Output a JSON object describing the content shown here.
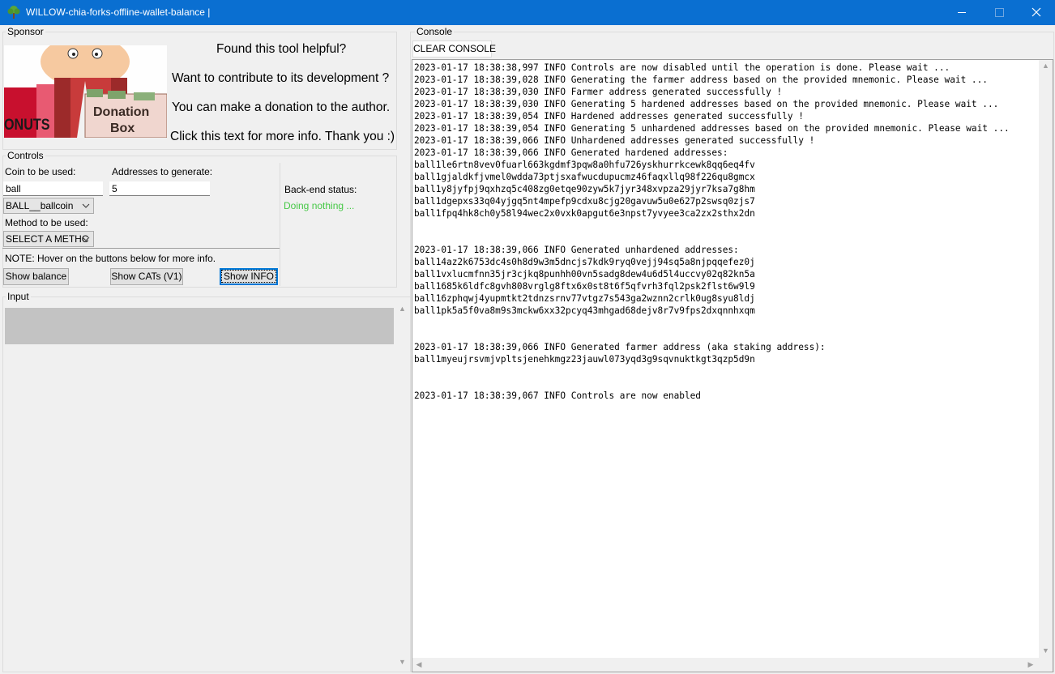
{
  "window": {
    "title": "WILLOW-chia-forks-offline-wallet-balance |",
    "icon": "tree-icon",
    "controls": {
      "minimize": "—",
      "maximize": "☐",
      "close": "✕"
    }
  },
  "sponsor": {
    "label": "Sponsor",
    "image_text": {
      "donation": "Donation",
      "box": "Box",
      "donuts": "ONUTS"
    },
    "lines": [
      "Found this tool helpful?",
      "Want to contribute to its development ?",
      "You can make a donation to the author.",
      "Click this text for more info. Thank you :)"
    ]
  },
  "controls": {
    "label": "Controls",
    "coin_label": "Coin to be used:",
    "coin_value": "ball",
    "coin_select": "BALL__ballcoin",
    "addresses_label": "Addresses to generate:",
    "addresses_value": "5",
    "method_label": "Method to be used:",
    "method_select": "SELECT A METHC",
    "backend_label": "Back-end status:",
    "backend_status": "Doing nothing ...",
    "backend_status_color": "#46c846",
    "note": "NOTE: Hover on the buttons below for more info.",
    "buttons": {
      "show_balance": "Show balance",
      "show_cats": "Show CATs (V1)",
      "show_info": "Show INFO"
    }
  },
  "input": {
    "label": "Input"
  },
  "console": {
    "label": "Console",
    "clear_button": "CLEAR CONSOLE",
    "lines": [
      "2023-01-17 18:38:38,997 INFO Controls are now disabled until the operation is done. Please wait ...",
      "2023-01-17 18:38:39,028 INFO Generating the farmer address based on the provided mnemonic. Please wait ...",
      "2023-01-17 18:38:39,030 INFO Farmer address generated successfully !",
      "2023-01-17 18:38:39,030 INFO Generating 5 hardened addresses based on the provided mnemonic. Please wait ...",
      "2023-01-17 18:38:39,054 INFO Hardened addresses generated successfully !",
      "2023-01-17 18:38:39,054 INFO Generating 5 unhardened addresses based on the provided mnemonic. Please wait ...",
      "2023-01-17 18:38:39,066 INFO Unhardened addresses generated successfully !",
      "2023-01-17 18:38:39,066 INFO Generated hardened addresses:",
      "ball1le6rtn8vev0fuarl663kgdmf3pqw8a0hfu726yskhurrkcewk8qq6eq4fv",
      "ball1gjaldkfjvmel0wdda73ptjsxafwucdupucmz46faqxllq98f226qu8gmcx",
      "ball1y8jyfpj9qxhzq5c408zg0etqe90zyw5k7jyr348xvpza29jyr7ksa7g8hm",
      "ball1dgepxs33q04yjgq5nt4mpefp9cdxu8cjg20gavuw5u0e627p2swsq0zjs7",
      "ball1fpq4hk8ch0y58l94wec2x0vxk0apgut6e3npst7yvyee3ca2zx2sthx2dn",
      "",
      "",
      "2023-01-17 18:38:39,066 INFO Generated unhardened addresses:",
      "ball14az2k6753dc4s0h8d9w3m5dncjs7kdk9ryq0vejj94sq5a8njpqqefez0j",
      "ball1vxlucmfnn35jr3cjkq8punhh00vn5sadg8dew4u6d5l4uccvy02q82kn5a",
      "ball1685k6ldfc8gvh808vrglg8ftx6x0st8t6f5qfvrh3fql2psk2flst6w9l9",
      "ball16zphqwj4yupmtkt2tdnzsrnv77vtgz7s543ga2wznn2crlk0ug8syu8ldj",
      "ball1pk5a5f0va8m9s3mckw6xx32pcyq43mhgad68dejv8r7v9fps2dxqnnhxqm",
      "",
      "",
      "2023-01-17 18:38:39,066 INFO Generated farmer address (aka staking address):",
      "ball1myeujrsvmjvpltsjenehkmgz23jauwl073yqd3g9sqvnuktkgt3qzp5d9n",
      "",
      "",
      "2023-01-17 18:38:39,067 INFO Controls are now enabled"
    ]
  }
}
